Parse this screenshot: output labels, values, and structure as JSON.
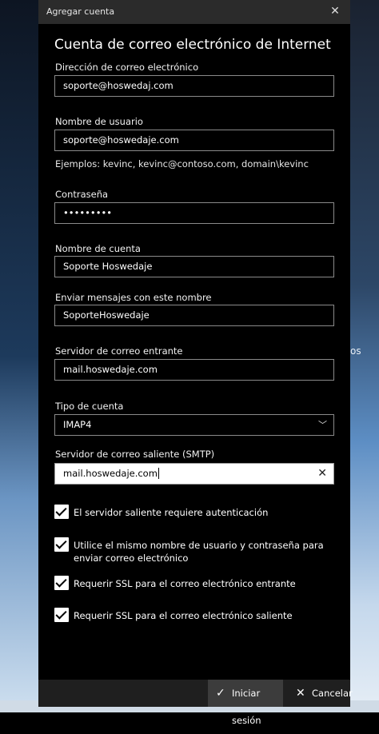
{
  "window": {
    "title": "Agregar cuenta",
    "close_icon": "close-icon"
  },
  "heading": "Cuenta de correo electrónico de Internet",
  "fields": {
    "email": {
      "label": "Dirección de correo electrónico",
      "value": "soporte@hoswedaj.com"
    },
    "username": {
      "label": "Nombre de usuario",
      "value": "soporte@hoswedaje.com",
      "hint": "Ejemplos: kevinc, kevinc@contoso.com, domain\\kevinc"
    },
    "password": {
      "label": "Contraseña",
      "value": "•••••••••"
    },
    "account_name": {
      "label": "Nombre de cuenta",
      "value": "Soporte Hoswedaje"
    },
    "send_name": {
      "label": "Enviar mensajes con este nombre",
      "value": "SoporteHoswedaje"
    },
    "incoming_server": {
      "label": "Servidor de correo entrante",
      "value": "mail.hoswedaje.com"
    },
    "account_type": {
      "label": "Tipo de cuenta",
      "value": "IMAP4"
    },
    "outgoing_server": {
      "label": "Servidor de correo saliente (SMTP)",
      "value": "mail.hoswedaje.com"
    }
  },
  "checkboxes": [
    {
      "label": "El servidor saliente requiere autenticación",
      "checked": true
    },
    {
      "label": "Utilice el mismo nombre de usuario y contraseña para enviar correo electrónico",
      "checked": true
    },
    {
      "label": "Requerir SSL para el correo electrónico entrante",
      "checked": true
    },
    {
      "label": "Requerir SSL para el correo electrónico saliente",
      "checked": true
    }
  ],
  "footer": {
    "signin_label": "Iniciar sesión",
    "cancel_label": "Cancelar"
  },
  "background_text": "os",
  "colors": {
    "dialog_bg": "#000000",
    "titlebar_bg": "#2b2b2b",
    "footer_bg": "#1f1f1f",
    "primary_btn_bg": "#3c3c3c"
  }
}
